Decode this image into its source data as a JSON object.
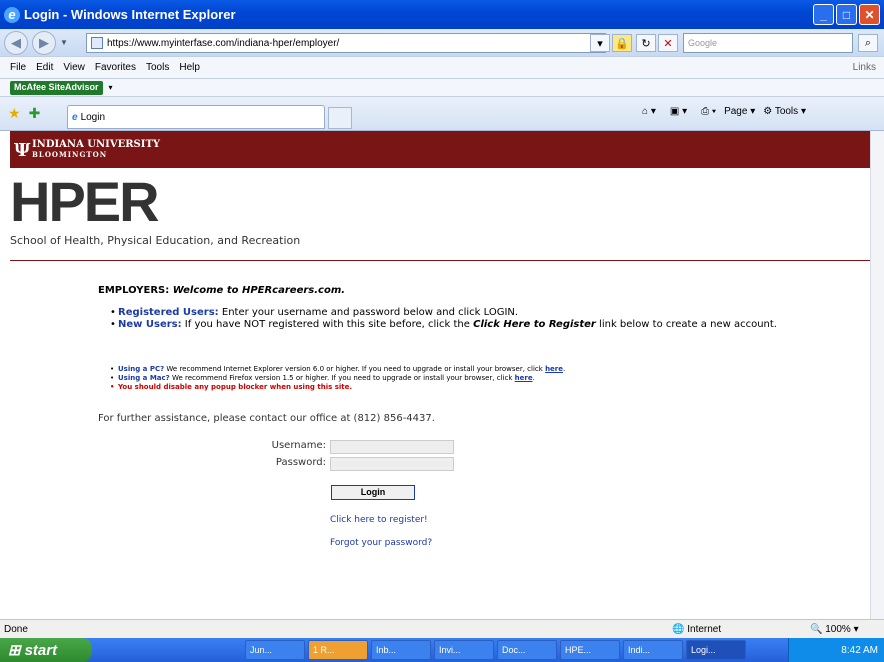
{
  "window": {
    "title": "Login - Windows Internet Explorer"
  },
  "address": {
    "url": "https://www.myinterfase.com/indiana-hper/employer/",
    "search_placeholder": "Google"
  },
  "menu": {
    "items": [
      "File",
      "Edit",
      "View",
      "Favorites",
      "Tools",
      "Help"
    ],
    "links": "Links"
  },
  "mcafee": {
    "label": "McAfee SiteAdvisor"
  },
  "tab": {
    "title": "Login"
  },
  "toolbar": {
    "page": "Page",
    "tools": "Tools"
  },
  "site": {
    "university": "INDIANA UNIVERSITY",
    "campus": "BLOOMINGTON",
    "logo": "HPER",
    "school": "School of Health, Physical Education, and Recreation",
    "employers_label": "EMPLOYERS:",
    "employers_welcome": "Welcome to HPERcareers.com.",
    "reg_users_label": "Registered Users:",
    "reg_users_text": "Enter your username and password below and click LOGIN.",
    "new_users_label": "New Users:",
    "new_users_text1": "If you have NOT registered with this site before, click the",
    "new_users_link": "Click Here to Register",
    "new_users_text2": "link below to create a new account.",
    "pc_label": "Using a PC?",
    "pc_text": "We recommend Internet Explorer version 6.0 or higher. If you need to upgrade or install your browser, click",
    "mac_label": "Using a Mac?",
    "mac_text": "We recommend Firefox version 1.5 or higher. If you need to upgrade or install your browser, click",
    "here": "here",
    "popup": "You should disable any popup blocker when using this site.",
    "assist": "For further assistance, please contact our office at (812) 856-4437.",
    "username_label": "Username:",
    "password_label": "Password:",
    "login": "Login",
    "register_link": "Click here to register!",
    "forgot_link": "Forgot your password?"
  },
  "status": {
    "text": "Done",
    "zone": "Internet",
    "zoom": "100%"
  },
  "taskbar": {
    "start": "start",
    "items": [
      "Jun...",
      "1 R...",
      "Inb...",
      "Invi...",
      "Doc...",
      "HPE...",
      "Indi...",
      "Logi..."
    ],
    "time": "8:42 AM"
  }
}
